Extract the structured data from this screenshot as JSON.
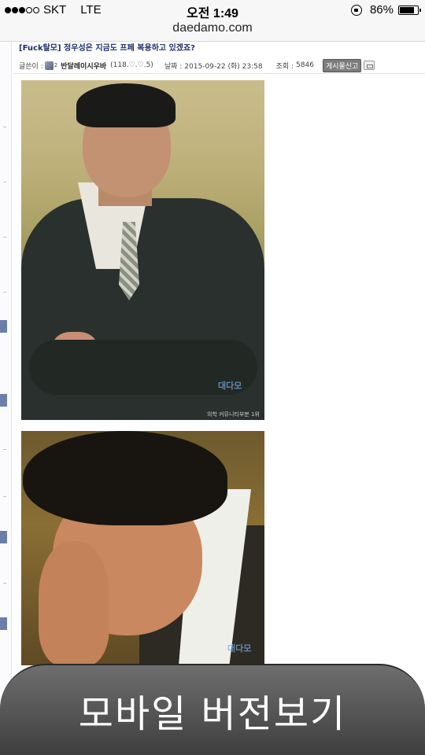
{
  "status_bar": {
    "carrier": "SKT",
    "network": "LTE",
    "time": "오전 1:49",
    "battery_percent": "86%",
    "battery_level": 0.86,
    "signal_bars_filled": 3,
    "signal_bars_total": 5
  },
  "url_bar": {
    "domain": "daedamo.com"
  },
  "post": {
    "title": "[Fuck탈모] 정우성은 지금도 프페 복용하고 있겠죠?",
    "author_label": "글쓴이 :",
    "level_badge": "2",
    "author": "반달레이시우바",
    "ip": "(118.♡.♡.5)",
    "date_label": "날짜 :",
    "date": "2015-09-22 (화) 23:58",
    "views_label": "조회 :",
    "views": "5846",
    "report_button": "게시물신고"
  },
  "photos": [
    {
      "watermark": "대다모",
      "caption": "의학 커뮤니티부분 1위"
    },
    {
      "watermark": "대다모",
      "caption": ""
    }
  ],
  "mobile_button": {
    "label": "모바일 버전보기"
  },
  "colors": {
    "title": "#1d2f6b",
    "rail_mark": "#6a7fa8",
    "button_bg": "#4f4f4f"
  }
}
